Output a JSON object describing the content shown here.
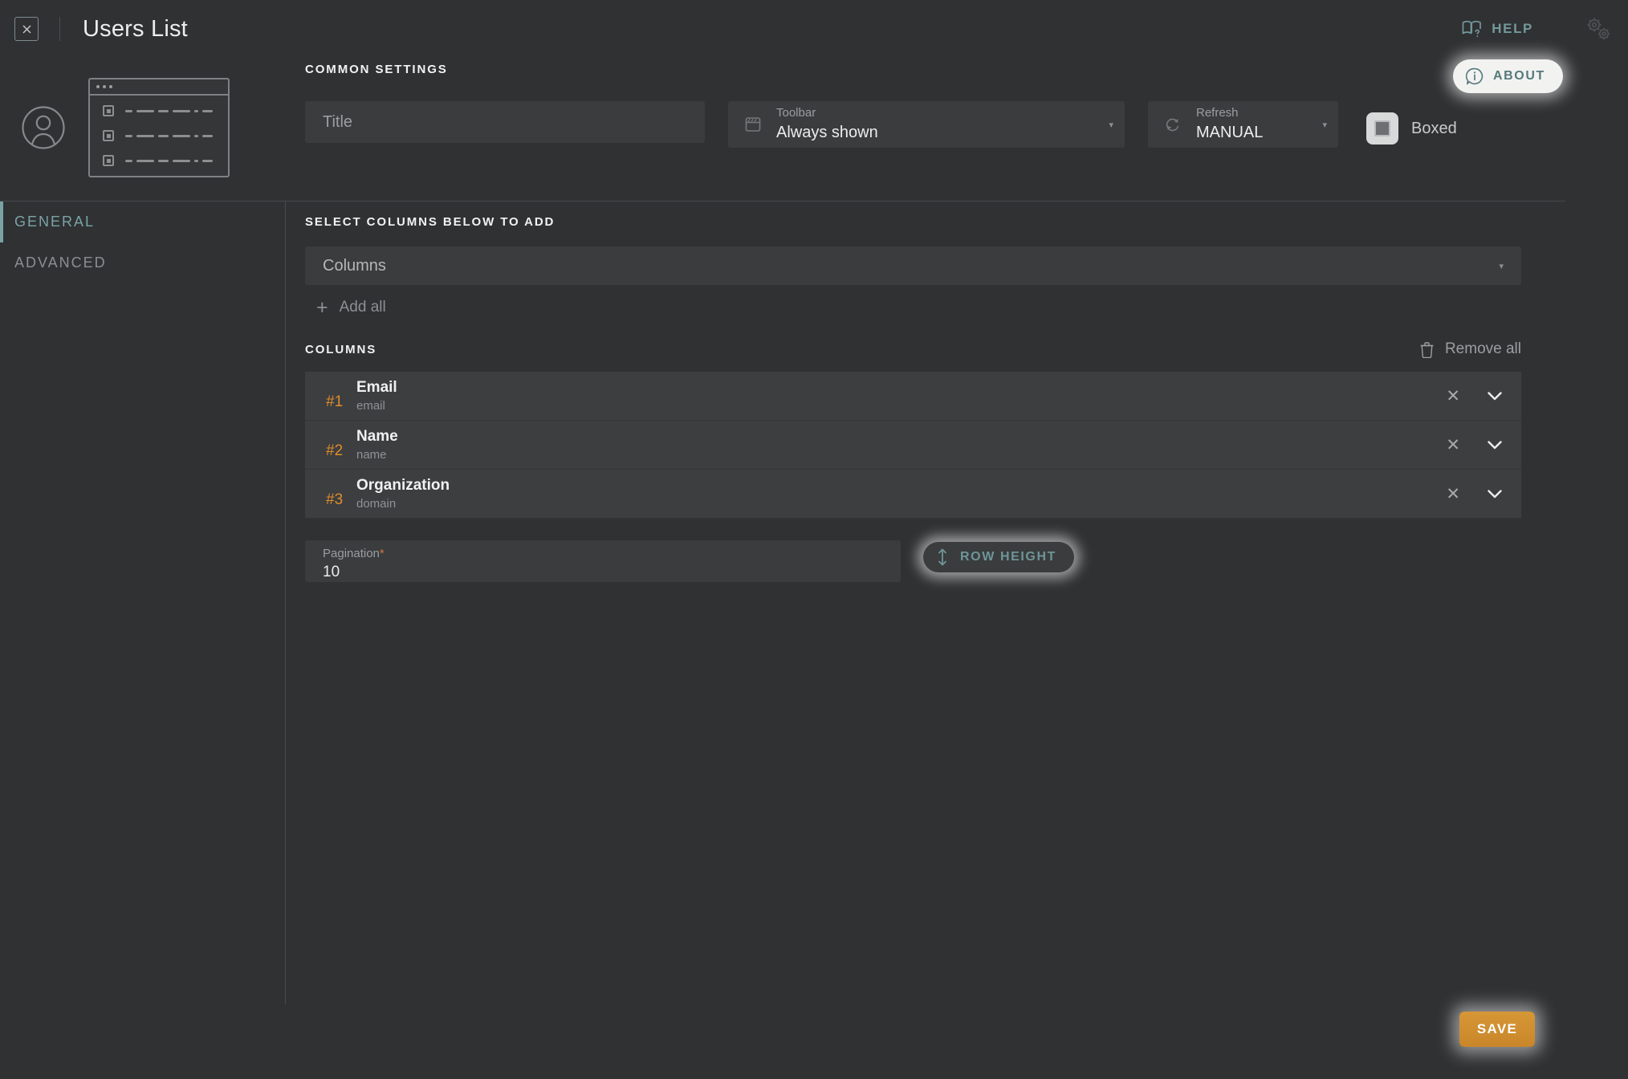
{
  "header": {
    "close_label": "×",
    "title": "Users List",
    "help_label": "HELP",
    "about_label": "ABOUT",
    "help_icon": "book-question-icon",
    "about_icon": "info-circle-icon",
    "gear_icon": "gears-icon"
  },
  "preview": {
    "avatar_icon": "user-avatar-icon",
    "thumb_icon": "list-window-preview-icon"
  },
  "common_settings": {
    "heading": "COMMON SETTINGS",
    "title_field": {
      "placeholder": "Title",
      "value": ""
    },
    "toolbar_field": {
      "label": "Toolbar",
      "value": "Always shown",
      "icon": "toolbar-icon"
    },
    "refresh_field": {
      "label": "Refresh",
      "value": "MANUAL",
      "icon": "refresh-icon"
    },
    "boxed_checkbox": {
      "label": "Boxed",
      "checked": false
    }
  },
  "sidebar": {
    "items": [
      {
        "label": "GENERAL",
        "active": true
      },
      {
        "label": "ADVANCED",
        "active": false
      }
    ]
  },
  "main": {
    "select_columns_heading": "SELECT COLUMNS BELOW TO ADD",
    "columns_select": {
      "placeholder": "Columns",
      "value": ""
    },
    "add_all_label": "Add all",
    "columns_heading": "COLUMNS",
    "remove_all_label": "Remove all",
    "columns": [
      {
        "rank": "#1",
        "name": "Email",
        "key": "email"
      },
      {
        "rank": "#2",
        "name": "Name",
        "key": "name"
      },
      {
        "rank": "#3",
        "name": "Organization",
        "key": "domain"
      }
    ],
    "pagination": {
      "label": "Pagination",
      "required_mark": "*",
      "value": "10"
    },
    "row_height_label": "ROW HEIGHT"
  },
  "footer": {
    "save_label": "SAVE"
  },
  "colors": {
    "app_bg": "#2f3133",
    "panel_bg": "#3a3c3e",
    "row_bg": "#3c3e40",
    "accent_teal": "#7ba3a6",
    "accent_orange": "#e08c2a",
    "save_orange": "#cf8c2e",
    "text_primary": "#eceded",
    "text_muted": "#8f9395"
  }
}
